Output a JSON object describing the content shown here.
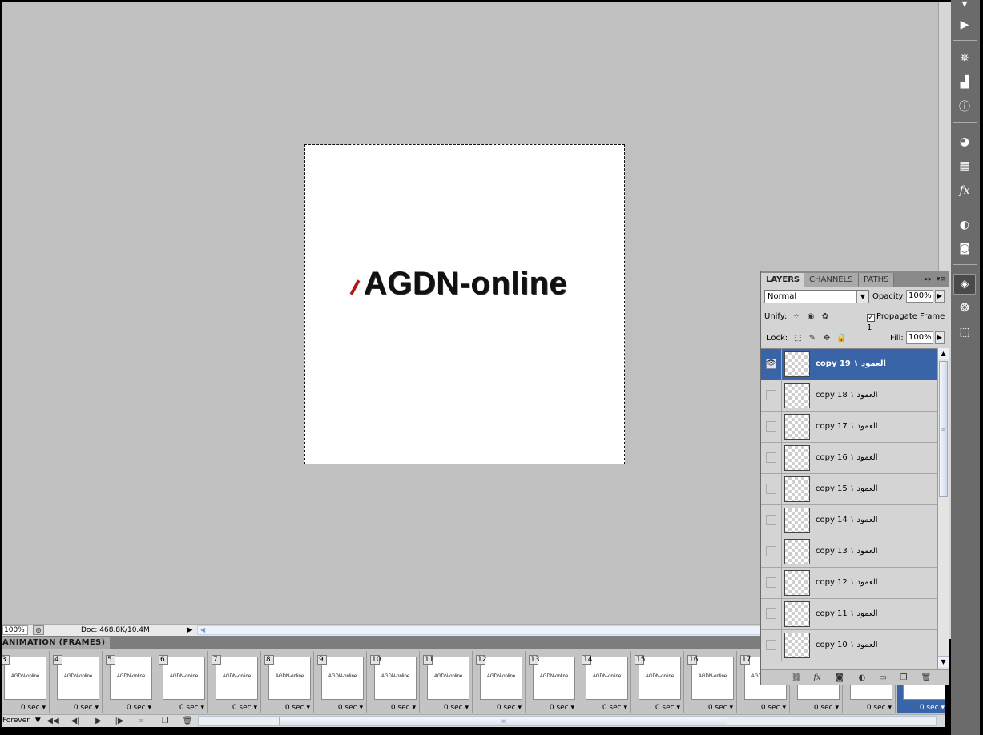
{
  "canvas": {
    "text": "AGDN-online"
  },
  "statusbar": {
    "zoom": "100%",
    "doc": "Doc: 468.8K/10.4M"
  },
  "animation": {
    "tab_label": "ANIMATION (FRAMES)",
    "loop": "Forever",
    "frames": [
      {
        "num": "3",
        "thumb_text": "AGDN-online",
        "delay": "0 sec."
      },
      {
        "num": "4",
        "thumb_text": "AGDN-online",
        "delay": "0 sec."
      },
      {
        "num": "5",
        "thumb_text": "AGDN-online",
        "delay": "0 sec."
      },
      {
        "num": "6",
        "thumb_text": "AGDN-online",
        "delay": "0 sec."
      },
      {
        "num": "7",
        "thumb_text": "AGDN-online",
        "delay": "0 sec."
      },
      {
        "num": "8",
        "thumb_text": "AGDN-online",
        "delay": "0 sec."
      },
      {
        "num": "9",
        "thumb_text": "AGDN-online",
        "delay": "0 sec."
      },
      {
        "num": "10",
        "thumb_text": "AGDN-online",
        "delay": "0 sec."
      },
      {
        "num": "11",
        "thumb_text": "AGDN-online",
        "delay": "0 sec."
      },
      {
        "num": "12",
        "thumb_text": "AGDN-online",
        "delay": "0 sec."
      },
      {
        "num": "13",
        "thumb_text": "AGDN-online",
        "delay": "0 sec."
      },
      {
        "num": "14",
        "thumb_text": "AGDN-online",
        "delay": "0 sec."
      },
      {
        "num": "15",
        "thumb_text": "AGDN-online",
        "delay": "0 sec."
      },
      {
        "num": "16",
        "thumb_text": "AGDN-online",
        "delay": "0 sec."
      },
      {
        "num": "17",
        "thumb_text": "AGDN-online",
        "delay": "0 sec."
      },
      {
        "num": "",
        "thumb_text": "",
        "delay": "0 sec."
      },
      {
        "num": "",
        "thumb_text": "",
        "delay": "0 sec."
      },
      {
        "num": "",
        "thumb_text": "",
        "delay": "0 sec."
      }
    ]
  },
  "layers_panel": {
    "tabs": [
      "LAYERS",
      "CHANNELS",
      "PATHS"
    ],
    "blend_mode": "Normal",
    "opacity_label": "Opacity:",
    "opacity": "100%",
    "unify_label": "Unify:",
    "propagate_label": "Propagate Frame 1",
    "lock_label": "Lock:",
    "fill_label": "Fill:",
    "fill": "100%",
    "layers": [
      {
        "name": "العمود ١ copy 19",
        "visible": true
      },
      {
        "name": "العمود ١ copy 18",
        "visible": false
      },
      {
        "name": "العمود ١ copy 17",
        "visible": false
      },
      {
        "name": "العمود ١ copy 16",
        "visible": false
      },
      {
        "name": "العمود ١ copy 15",
        "visible": false
      },
      {
        "name": "العمود ١ copy 14",
        "visible": false
      },
      {
        "name": "العمود ١ copy 13",
        "visible": false
      },
      {
        "name": "العمود ١ copy 12",
        "visible": false
      },
      {
        "name": "العمود ١ copy 11",
        "visible": false
      },
      {
        "name": "العمود ١ copy 10",
        "visible": false
      }
    ]
  },
  "dock": {
    "icons": [
      "play-icon",
      "navigator-icon",
      "histogram-icon",
      "info-icon",
      "color-icon",
      "swatches-icon",
      "styles-icon",
      "adjustments-icon",
      "masks-icon",
      "layers-icon",
      "channels-icon",
      "paths-icon"
    ]
  },
  "colors": {
    "selection": "#3a64a8",
    "workspace": "#c0c0c0",
    "panel": "#d4d4d4"
  }
}
